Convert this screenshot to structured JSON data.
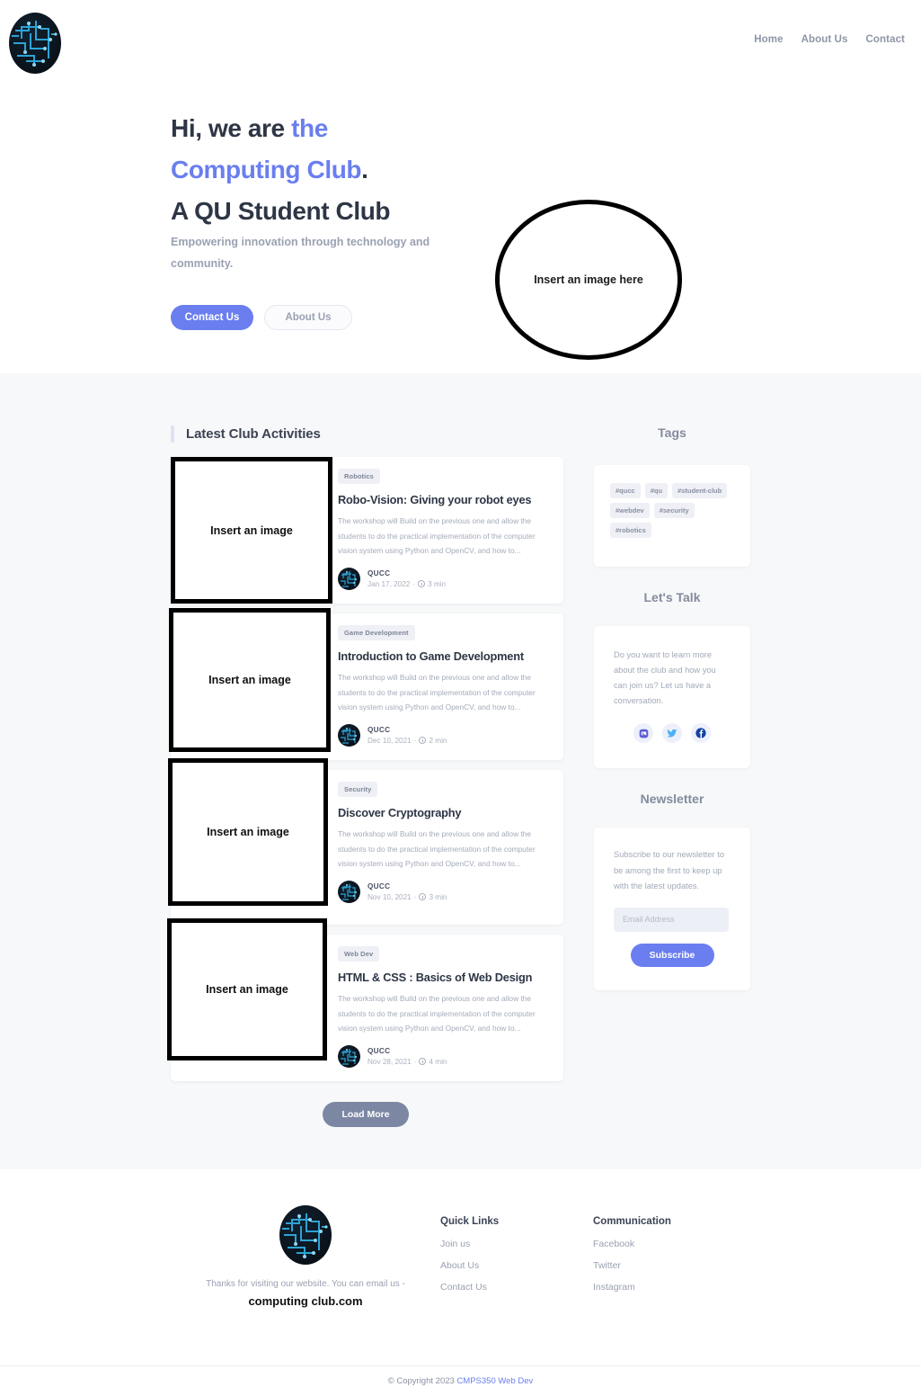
{
  "header": {
    "logo_name": "qucc-circuit-logo",
    "nav": [
      {
        "label": "Home"
      },
      {
        "label": "About Us"
      },
      {
        "label": "Contact"
      }
    ]
  },
  "hero": {
    "title_line1_plain": "Hi, we are ",
    "title_line1_accent": "the",
    "title_line2_accent": "Computing  Club",
    "title_line2_plain": ".",
    "title_line3": "A QU Student Club",
    "subtitle": "Empowering innovation through technology and community.",
    "primary_button": "Contact Us",
    "secondary_button": "About Us",
    "image_placeholder": "Insert an image here"
  },
  "activities": {
    "heading": "Latest Club Activities",
    "image_placeholder": "Insert an image",
    "load_more": "Load More",
    "cards": [
      {
        "tag": "Robotics",
        "title": "Robo-Vision: Giving your robot eyes",
        "excerpt": "The workshop will Build on the previous one and allow the students to do the practical implementation of the computer vision system using Python and OpenCV, and how to...",
        "author": "QUCC",
        "date": "Jan 17, 2022",
        "read_time": "3 min"
      },
      {
        "tag": "Game Development",
        "title": "Introduction to Game Development",
        "excerpt": "The workshop will Build on the previous one and allow the students to do the practical implementation of the computer vision system using Python and OpenCV, and how to...",
        "author": "QUCC",
        "date": "Dec 10, 2021",
        "read_time": "2 min"
      },
      {
        "tag": "Security",
        "title": "Discover Cryptography",
        "excerpt": "The workshop will Build on the previous one and allow the students to do the practical implementation of the computer vision system using Python and OpenCV, and how to...",
        "author": "QUCC",
        "date": "Nov 10, 2021",
        "read_time": "3 min"
      },
      {
        "tag": "Web Dev",
        "title": "HTML & CSS : Basics of Web Design",
        "excerpt": "The workshop will Build on the previous one and allow the students to do the practical implementation of the computer vision system using Python and OpenCV, and how to...",
        "author": "QUCC",
        "date": "Nov 28, 2021",
        "read_time": "4 min"
      }
    ]
  },
  "sidebar": {
    "tags_title": "Tags",
    "tags": [
      "#qucc",
      "#qu",
      "#student-club",
      "#webdev",
      "#security",
      "#robotics"
    ],
    "talk_title": "Let's Talk",
    "talk_text": "Do you want to learn more about the club and how you can join us? Let us have a conversation.",
    "socials": [
      {
        "name": "instagram-icon"
      },
      {
        "name": "twitter-icon"
      },
      {
        "name": "facebook-icon"
      }
    ],
    "newsletter_title": "Newsletter",
    "newsletter_text": "Subscribe to our newsletter to be among the first to keep up with the latest updates.",
    "email_placeholder": "Email Address",
    "email_value": "",
    "subscribe_label": "Subscribe"
  },
  "footer": {
    "thanks": "Thanks for visiting our website. You can email us -",
    "email": "computing club.com",
    "quick_links_title": "Quick Links",
    "quick_links": [
      {
        "label": "Join us"
      },
      {
        "label": "About Us"
      },
      {
        "label": "Contact Us"
      }
    ],
    "communication_title": "Communication",
    "communication": [
      {
        "label": "Facebook"
      },
      {
        "label": "Twitter"
      },
      {
        "label": "Instagram"
      }
    ],
    "copyright_prefix": "© Copyright 2023 ",
    "copyright_link": "CMPS350 Web Dev"
  },
  "colors": {
    "accent": "#6a7ef0",
    "band_bg": "#f7f8f9",
    "heading": "#2e3646",
    "muted": "#9aa1b1"
  }
}
